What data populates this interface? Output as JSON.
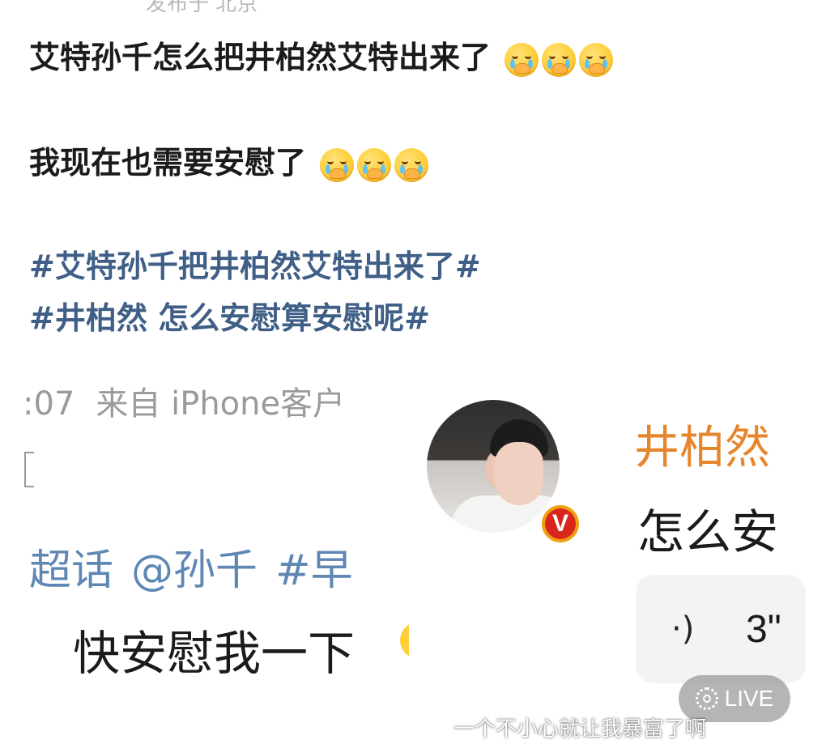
{
  "post": {
    "line1": "艾特孙千怎么把井柏然艾特出来了",
    "line2": "我现在也需要安慰了",
    "hashtag1": "#艾特孙千把井柏然艾特出来了#",
    "hashtag2": "#井柏然 怎么安慰算安慰呢#"
  },
  "emoji": {
    "name": "crying-face-emoji"
  },
  "screenshot_left": {
    "time": ":07",
    "source": "来自 iPhone客户",
    "tags": [
      "超话",
      "@孙千",
      "#早"
    ],
    "text": "快安慰我一下"
  },
  "screenshot_right": {
    "username": "井柏然",
    "preview": "怎么安",
    "badge": "V",
    "voice_duration": "3\""
  },
  "live_badge": {
    "label": "LIVE"
  },
  "watermark": {
    "text": "一个不小心就让我暴富了啊"
  }
}
